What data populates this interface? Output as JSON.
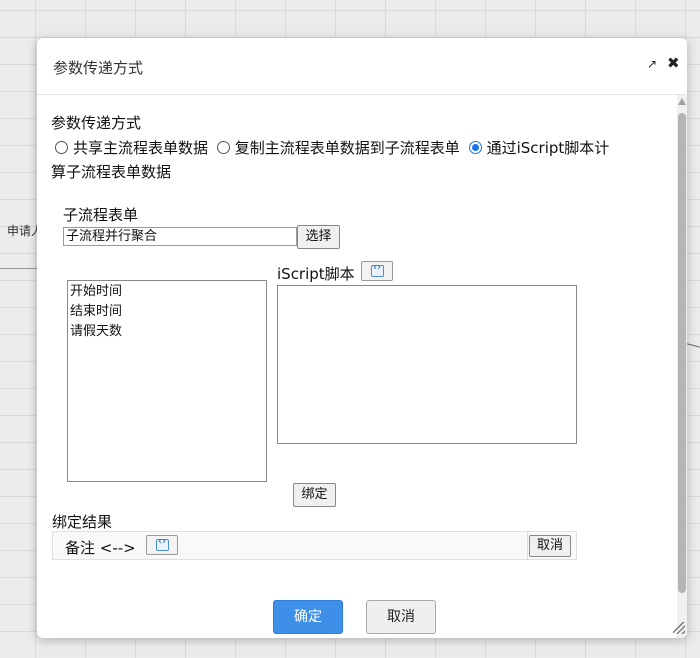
{
  "background": {
    "label": "申请人"
  },
  "dialog": {
    "title": "参数传递方式",
    "section_title": "参数传递方式",
    "radio_options": [
      {
        "label": "共享主流程表单数据",
        "checked": false
      },
      {
        "label": "复制主流程表单数据到子流程表单",
        "checked": false
      },
      {
        "label": "通过iScript脚本计",
        "checked": true
      }
    ],
    "radio_wrap_text": "算子流程表单数据",
    "subform": {
      "label": "子流程表单",
      "value": "子流程并行聚合",
      "select_button": "选择"
    },
    "fields": [
      "开始时间",
      "结束时间",
      "请假天数"
    ],
    "script": {
      "label": "iScript脚本",
      "value": ""
    },
    "bind_button": "绑定",
    "result": {
      "label": "绑定结果",
      "text": "备注  <-->",
      "cancel_button": "取消"
    },
    "confirm_button": "确定",
    "cancel_button": "取消"
  },
  "colors": {
    "primary": "#3d8fe8",
    "radio_checked": "#1a73e8"
  },
  "icons": [
    "external-link-icon",
    "close-icon",
    "code-editor-icon"
  ]
}
